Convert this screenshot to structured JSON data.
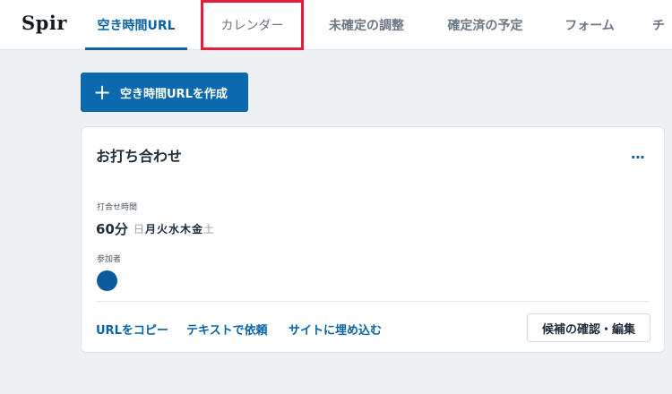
{
  "app": {
    "logo": "Spir"
  },
  "nav": {
    "tabs": [
      {
        "label": "空き時間URL",
        "state": "active"
      },
      {
        "label": "カレンダー",
        "state": "highlighted"
      },
      {
        "label": "未確定の調整",
        "state": "normal"
      },
      {
        "label": "確定済の予定",
        "state": "normal"
      },
      {
        "label": "フォーム",
        "state": "normal"
      },
      {
        "label": "チ",
        "state": "normal"
      }
    ]
  },
  "actions": {
    "create_label": "空き時間URLを作成",
    "create_icon": "plus-icon"
  },
  "card": {
    "title": "お打ち合わせ",
    "more_label": "...",
    "duration_label": "打合せ時間",
    "duration_value": "60分",
    "days": [
      {
        "label": "日",
        "active": false
      },
      {
        "label": "月",
        "active": true
      },
      {
        "label": "火",
        "active": true
      },
      {
        "label": "水",
        "active": true
      },
      {
        "label": "木",
        "active": true
      },
      {
        "label": "金",
        "active": true
      },
      {
        "label": "土",
        "active": false
      }
    ],
    "participants_label": "参加者",
    "participant_avatar_color": "#0b5a9e",
    "links": {
      "copy_url": "URLをコピー",
      "request_text": "テキストで依頼",
      "embed": "サイトに埋め込む"
    },
    "confirm_button": "候補の確認・編集"
  },
  "colors": {
    "accent": "#0b63a6",
    "highlight_border": "#e0203b",
    "background": "#eef1f4"
  }
}
